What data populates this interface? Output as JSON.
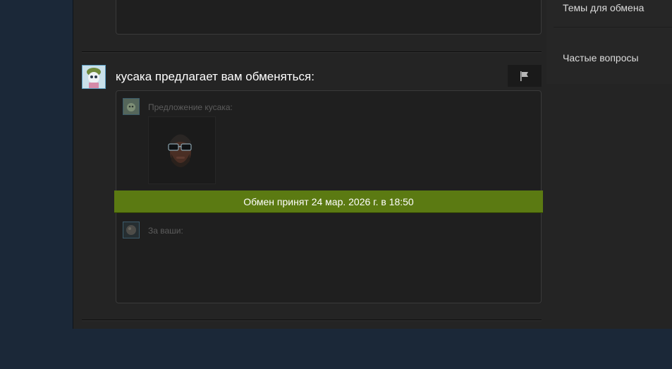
{
  "offer": {
    "title": "кусака предлагает вам обменяться:",
    "their_offer_label": "Предложение кусака:",
    "your_offer_label": "За ваши:",
    "status": "Обмен принят 24 мар. 2026 г. в 18:50"
  },
  "sidebar": {
    "links": [
      {
        "label": "Темы для обмена"
      },
      {
        "label": "Частые вопросы"
      }
    ]
  },
  "icons": {
    "report": "flag-icon",
    "item": "bearded-man-with-glasses-icon"
  },
  "colors": {
    "status_banner": "#5b7a12",
    "background": "#1b2838",
    "panel": "#242424"
  }
}
